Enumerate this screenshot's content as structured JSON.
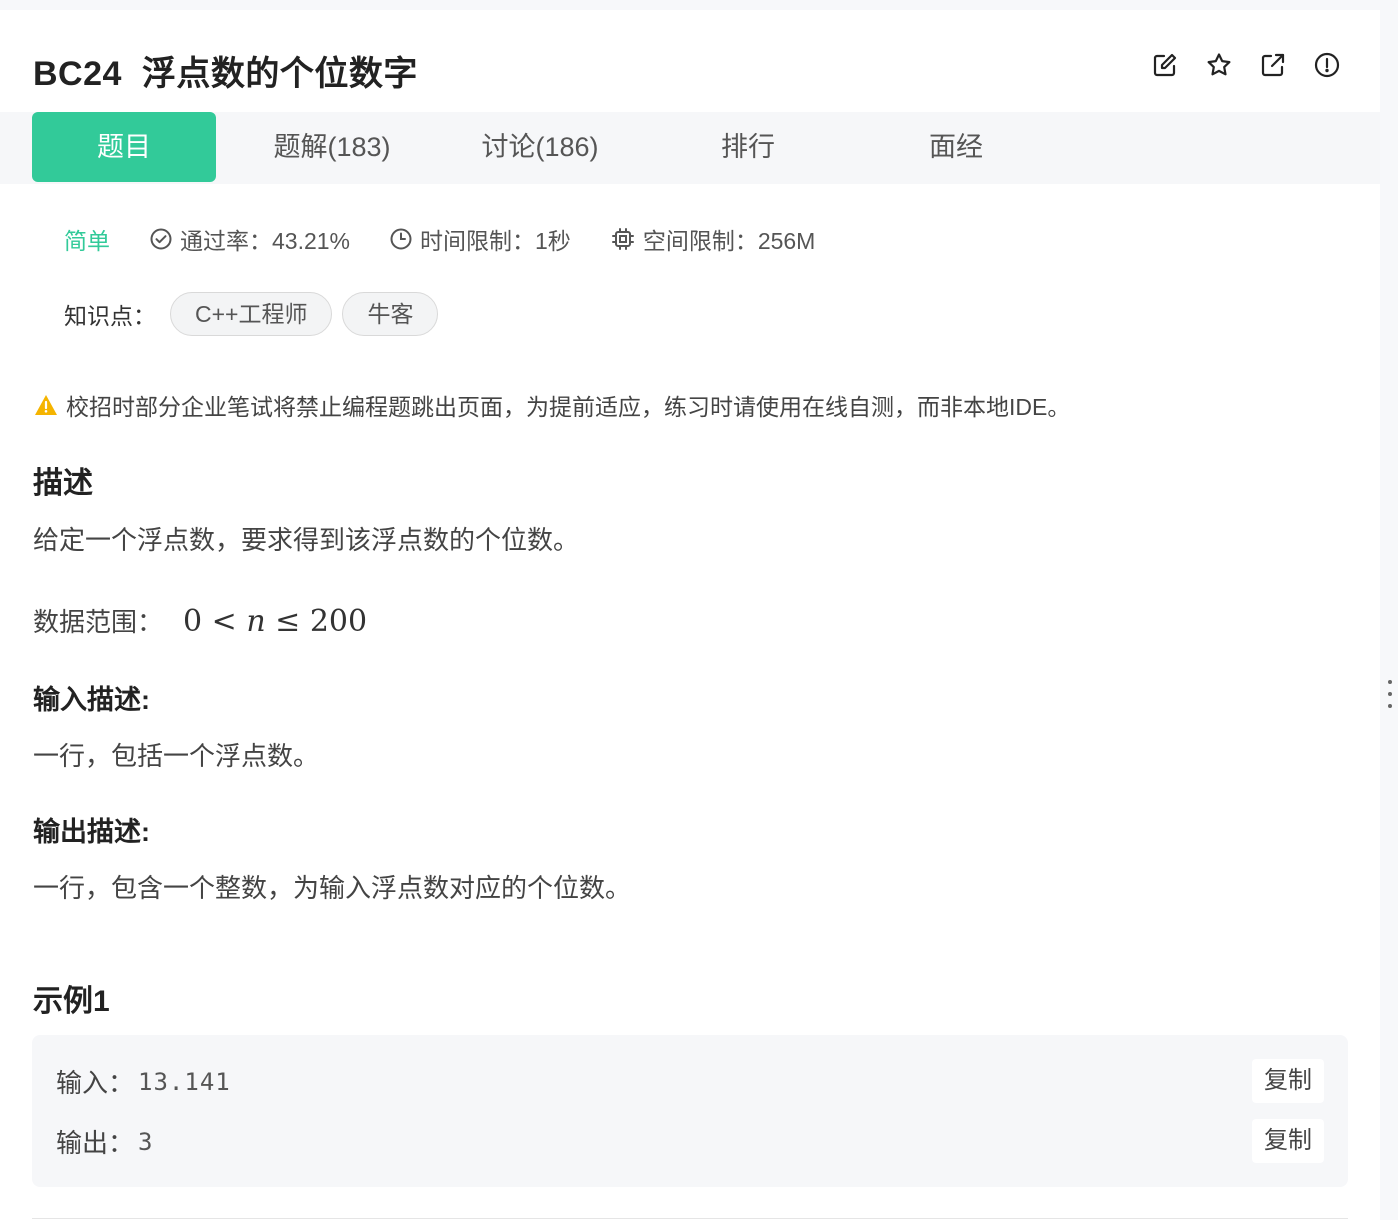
{
  "header": {
    "problem_id": "BC24",
    "problem_title": "浮点数的个位数字",
    "icons": [
      "edit-icon",
      "star-icon",
      "external-link-icon",
      "report-icon"
    ]
  },
  "tabs": [
    {
      "label": "题目",
      "active": true
    },
    {
      "label": "题解(183)",
      "active": false
    },
    {
      "label": "讨论(186)",
      "active": false
    },
    {
      "label": "排行",
      "active": false
    },
    {
      "label": "面经",
      "active": false
    }
  ],
  "meta": {
    "difficulty": "简单",
    "pass_rate": "通过率：43.21%",
    "time_limit": "时间限制：1秒",
    "space_limit": "空间限制：256M"
  },
  "knowledge": {
    "label": "知识点：",
    "tags": [
      "C++工程师",
      "牛客"
    ]
  },
  "warning": "校招时部分企业笔试将禁止编程题跳出页面，为提前适应，练习时请使用在线自测，而非本地IDE。",
  "description": {
    "heading": "描述",
    "text": "给定一个浮点数，要求得到该浮点数的个位数。",
    "range_label": "数据范围：",
    "range_lhs": "0 < ",
    "range_var": "n",
    "range_rhs": " ≤ 200"
  },
  "input_desc": {
    "heading": "输入描述:",
    "text": "一行，包括一个浮点数。"
  },
  "output_desc": {
    "heading": "输出描述:",
    "text": "一行，包含一个整数，为输入浮点数对应的个位数。"
  },
  "example": {
    "heading": "示例1",
    "input_label": "输入：",
    "input_value": "13.141",
    "output_label": "输出：",
    "output_value": "3",
    "copy_label": "复制"
  },
  "colors": {
    "accent": "#32ca99",
    "warning": "#f5b400"
  }
}
